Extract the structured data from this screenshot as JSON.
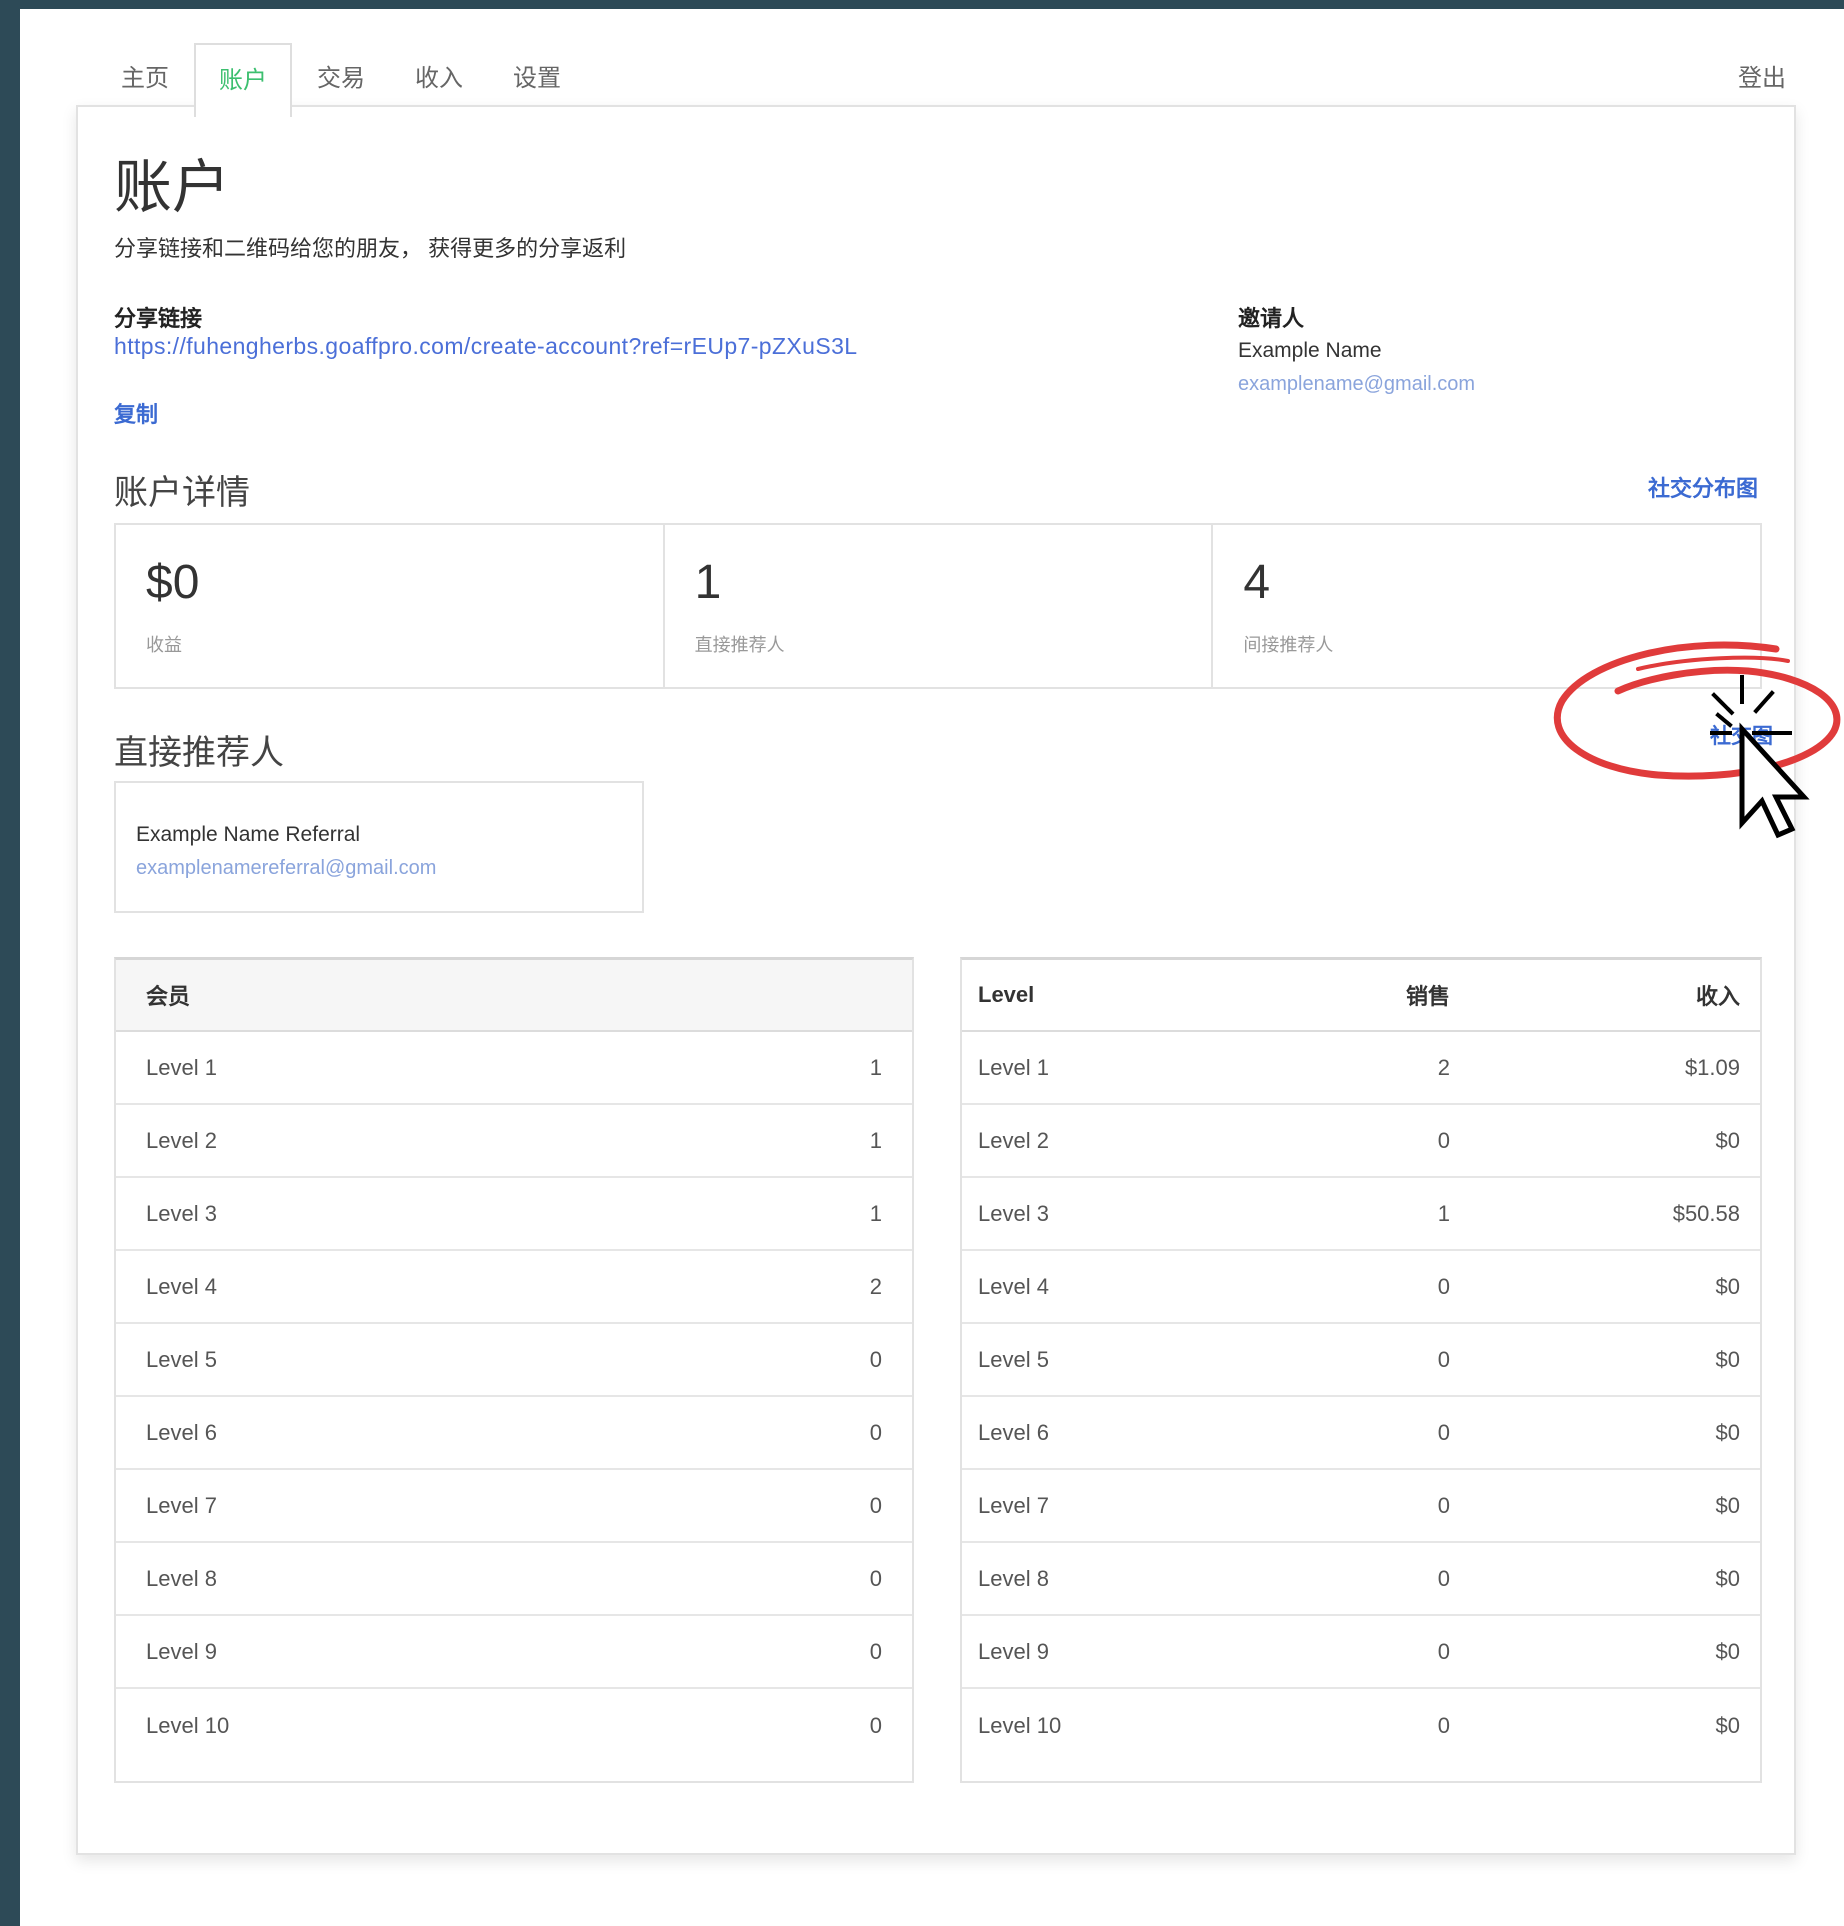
{
  "nav": {
    "tabs": [
      {
        "label": "主页"
      },
      {
        "label": "账户"
      },
      {
        "label": "交易"
      },
      {
        "label": "收入"
      },
      {
        "label": "设置"
      }
    ],
    "active_tab": "账户",
    "logout_label": "登出"
  },
  "header": {
    "title": "账户",
    "subtitle": "分享链接和二维码给您的朋友， 获得更多的分享返利"
  },
  "share": {
    "label": "分享链接",
    "url": "https://fuhengherbs.goaffpro.com/create-account?ref=rEUp7-pZXuS3L",
    "copy_label": "复制"
  },
  "inviter": {
    "label": "邀请人",
    "name": "Example Name",
    "email": "examplename@gmail.com"
  },
  "account_details": {
    "title": "账户详情",
    "social_map_link": "社交分布图",
    "stats": [
      {
        "value": "$0",
        "label": "收益"
      },
      {
        "value": "1",
        "label": "直接推荐人"
      },
      {
        "value": "4",
        "label": "间接推荐人"
      }
    ]
  },
  "direct_referrals": {
    "title": "直接推荐人",
    "items": [
      {
        "name": "Example Name Referral",
        "email": "examplenamereferral@gmail.com"
      }
    ],
    "highlighted_link": "社交图"
  },
  "members_table": {
    "header": "会员",
    "rows": [
      {
        "level": "Level 1",
        "count": "1"
      },
      {
        "level": "Level 2",
        "count": "1"
      },
      {
        "level": "Level 3",
        "count": "1"
      },
      {
        "level": "Level 4",
        "count": "2"
      },
      {
        "level": "Level 5",
        "count": "0"
      },
      {
        "level": "Level 6",
        "count": "0"
      },
      {
        "level": "Level 7",
        "count": "0"
      },
      {
        "level": "Level 8",
        "count": "0"
      },
      {
        "level": "Level 9",
        "count": "0"
      },
      {
        "level": "Level 10",
        "count": "0"
      }
    ]
  },
  "earnings_table": {
    "headers": {
      "level": "Level",
      "sales": "销售",
      "income": "收入"
    },
    "rows": [
      {
        "level": "Level 1",
        "sales": "2",
        "income": "$1.09"
      },
      {
        "level": "Level 2",
        "sales": "0",
        "income": "$0"
      },
      {
        "level": "Level 3",
        "sales": "1",
        "income": "$50.58"
      },
      {
        "level": "Level 4",
        "sales": "0",
        "income": "$0"
      },
      {
        "level": "Level 5",
        "sales": "0",
        "income": "$0"
      },
      {
        "level": "Level 6",
        "sales": "0",
        "income": "$0"
      },
      {
        "level": "Level 7",
        "sales": "0",
        "income": "$0"
      },
      {
        "level": "Level 8",
        "sales": "0",
        "income": "$0"
      },
      {
        "level": "Level 9",
        "sales": "0",
        "income": "$0"
      },
      {
        "level": "Level 10",
        "sales": "0",
        "income": "$0"
      }
    ]
  },
  "colors": {
    "frame": "#2d4a57",
    "active_tab": "#3cbf6f",
    "link": "#4b6fd8",
    "annotation": "#e03b3b"
  },
  "icons": [
    "mouse-pointer-icon",
    "click-burst-icon"
  ]
}
